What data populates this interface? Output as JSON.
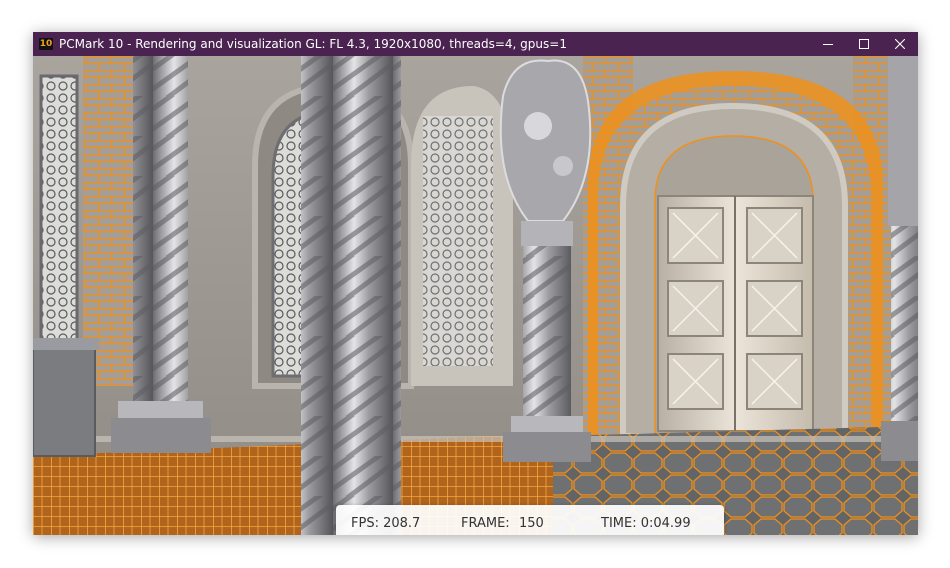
{
  "window": {
    "app_icon_text": "10",
    "title": "PCMark 10 - Rendering and visualization GL: FL 4.3, 1920x1080, threads=4, gpus=1",
    "controls": {
      "minimize": "minimize-icon",
      "maximize": "maximize-icon",
      "close": "close-icon"
    },
    "titlebar_color": "#4a2350"
  },
  "scene": {
    "description_icon": "3d-render-cathedral",
    "accent_color": "#f0901a"
  },
  "hud": {
    "fps_text": "FPS: 208.7",
    "frame_label": "FRAME:",
    "frame_value": "150",
    "time_text": "TIME: 0:04.99"
  }
}
